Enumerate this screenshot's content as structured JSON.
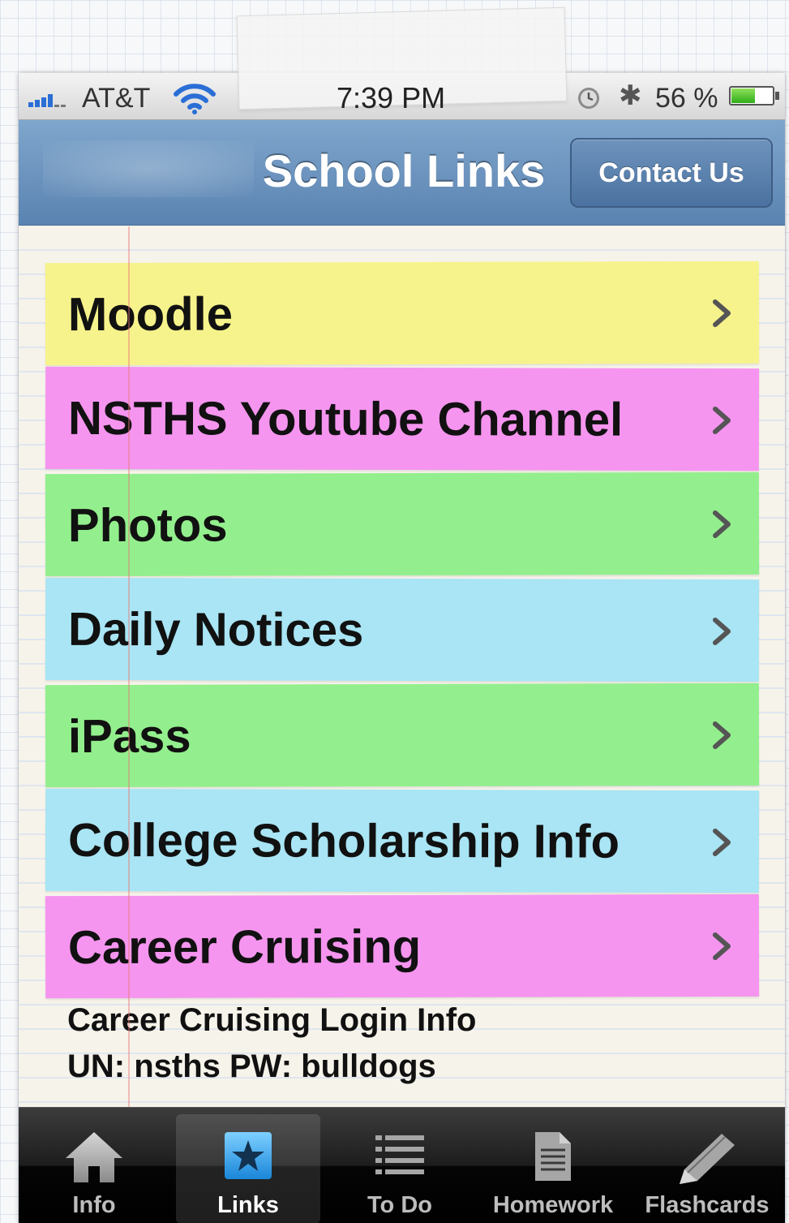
{
  "status_bar": {
    "carrier": "AT&T",
    "time": "7:39 PM",
    "battery_percent": "56 %",
    "battery_level": 0.56
  },
  "nav_bar": {
    "title": "School Links",
    "contact_button": "Contact Us"
  },
  "links": [
    {
      "label": "Moodle",
      "color": "#f7f38c"
    },
    {
      "label": "NSTHS Youtube Channel",
      "color": "#f595ef"
    },
    {
      "label": "Photos",
      "color": "#93ef8d"
    },
    {
      "label": "Daily Notices",
      "color": "#a9e5f4"
    },
    {
      "label": "iPass",
      "color": "#93ef8d"
    },
    {
      "label": "College Scholarship Info",
      "color": "#a9e5f4"
    },
    {
      "label": "Career Cruising",
      "color": "#f595ef"
    }
  ],
  "notes": {
    "line1": "Career Cruising Login Info",
    "line2": "UN: nsths PW: bulldogs"
  },
  "tab_bar": {
    "active": "Links",
    "tabs": [
      {
        "label": "Info",
        "icon": "home-icon"
      },
      {
        "label": "Links",
        "icon": "star-icon"
      },
      {
        "label": "To Do",
        "icon": "list-icon"
      },
      {
        "label": "Homework",
        "icon": "document-icon"
      },
      {
        "label": "Flashcards",
        "icon": "pencil-icon"
      }
    ]
  }
}
